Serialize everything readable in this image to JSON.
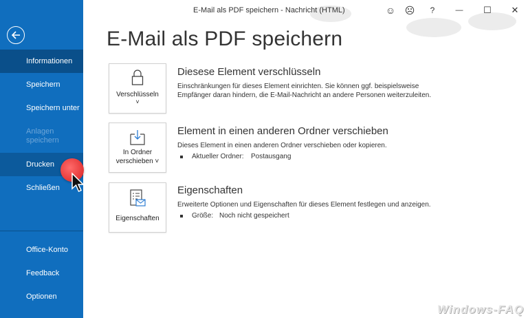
{
  "window": {
    "title": "E-Mail als PDF speichern  -  Nachricht (HTML)",
    "smile_icon": "☺",
    "frown_icon": "☹",
    "help": "?",
    "minimize": "—",
    "maximize": "☐",
    "close": "✕"
  },
  "sidebar": {
    "items": [
      {
        "label": "Informationen"
      },
      {
        "label": "Speichern"
      },
      {
        "label": "Speichern unter"
      },
      {
        "label": "Anlagen speichern"
      },
      {
        "label": "Drucken"
      },
      {
        "label": "Schließen"
      },
      {
        "label": "Office-Konto"
      },
      {
        "label": "Feedback"
      },
      {
        "label": "Optionen"
      }
    ]
  },
  "main": {
    "title": "E-Mail als PDF speichern",
    "sections": [
      {
        "button": "Verschlüsseln",
        "chevron": "˅",
        "title": "Diesese Element verschlüsseln",
        "desc": "Einschränkungen für dieses Element einrichten. Sie können ggf. beispielsweise Empfänger daran hindern, die E-Mail-Nachricht an andere Personen weiterzuleiten."
      },
      {
        "button_line1": "In Ordner",
        "button_line2": "verschieben ˅",
        "title": "Element in einen anderen Ordner verschieben",
        "desc": "Dieses Element in einen anderen Ordner verschieben oder kopieren.",
        "bullet_key": "Aktueller Ordner:",
        "bullet_value": "Postausgang"
      },
      {
        "button": "Eigenschaften",
        "title": "Eigenschaften",
        "desc": "Erweiterte Optionen und Eigenschaften für dieses Element festlegen und anzeigen.",
        "bullet_key": "Größe:",
        "bullet_value": "Noch nicht gespeichert"
      }
    ]
  },
  "watermark": "Windows-FAQ",
  "colors": {
    "sidebar": "#106ebe",
    "sidebar_active": "#0a4f8a",
    "cursor": "#e02424"
  }
}
